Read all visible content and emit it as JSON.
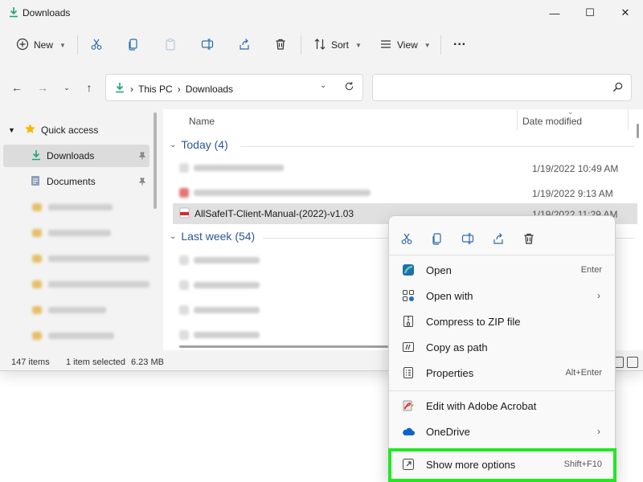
{
  "window": {
    "title": "Downloads",
    "controls": {
      "minimize": "—",
      "maximize": "☐",
      "close": "✕"
    }
  },
  "toolbar": {
    "new_label": "New",
    "sort_label": "Sort",
    "view_label": "View",
    "more_label": "···"
  },
  "address": {
    "crumbs": [
      "This PC",
      "Downloads"
    ],
    "separator": "›"
  },
  "search": {
    "placeholder": ""
  },
  "sidebar": {
    "quick_access": "Quick access",
    "downloads": "Downloads",
    "documents": "Documents"
  },
  "columns": {
    "name": "Name",
    "date_modified": "Date modified"
  },
  "groups": {
    "today": "Today (4)",
    "last_week": "Last week (54)"
  },
  "files": [
    {
      "name": "",
      "date": "1/19/2022 10:49 AM",
      "redacted": true
    },
    {
      "name": "",
      "date": "1/19/2022 9:13 AM",
      "redacted": true
    },
    {
      "name": "AllSafeIT-Client-Manual-(2022)-v1.03",
      "date": "1/19/2022 11:29 AM",
      "redacted": false
    }
  ],
  "status": {
    "items": "147 items",
    "selected": "1 item selected",
    "size": "6.23 MB"
  },
  "context_menu": {
    "items": [
      {
        "label": "Open",
        "shortcut": "Enter"
      },
      {
        "label": "Open with",
        "shortcut": ""
      },
      {
        "label": "Compress to ZIP file",
        "shortcut": ""
      },
      {
        "label": "Copy as path",
        "shortcut": ""
      },
      {
        "label": "Properties",
        "shortcut": "Alt+Enter"
      },
      {
        "label": "Edit with Adobe Acrobat",
        "shortcut": ""
      },
      {
        "label": "OneDrive",
        "shortcut": ""
      },
      {
        "label": "Show more options",
        "shortcut": "Shift+F10"
      }
    ],
    "chevron": "›"
  },
  "colors": {
    "accent_green": "#22e822",
    "group_blue": "#2b5797",
    "download_arrow": "#1aa37a",
    "star": "#f5b800"
  }
}
